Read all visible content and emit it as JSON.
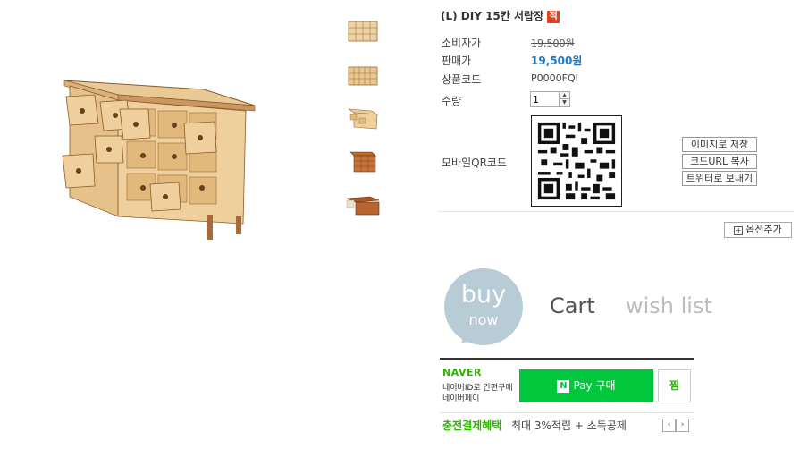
{
  "product": {
    "title": "(L) DIY 15칸 서랍장",
    "badge": "적",
    "consumer_price_label": "소비자가",
    "consumer_price": "19,500원",
    "sale_price_label": "판매가",
    "sale_price": "19,500원",
    "code_label": "상품코드",
    "code": "P0000FQI",
    "qty_label": "수량",
    "qty_value": "1",
    "qr_label": "모바일QR코드"
  },
  "qr_buttons": [
    "이미지로 저장",
    "코드URL 복사",
    "트위터로 보내기"
  ],
  "option_button": "옵션추가",
  "actions": {
    "buy_line1": "buy",
    "buy_line2": "now",
    "cart": "Cart",
    "wish": "wish list"
  },
  "naver": {
    "logo": "NAVER",
    "desc1": "네이버ID로 간편구매",
    "desc2": "네이버페이",
    "pay_mark": "N",
    "pay_label": "Pay 구매",
    "zzim": "찜",
    "benefit_label": "충전결제혜택",
    "benefit_text": "최대 3%적립 + 소득공제"
  },
  "icons": {
    "prev": "chevron-left-icon",
    "next": "chevron-right-icon",
    "plus": "plus-icon"
  },
  "colors": {
    "sale_price": "#1a77c9",
    "badge": "#e2421f",
    "naver_green": "#00c73c",
    "buy_bubble": "#b7ccd5",
    "wood": "#e8c48a"
  }
}
